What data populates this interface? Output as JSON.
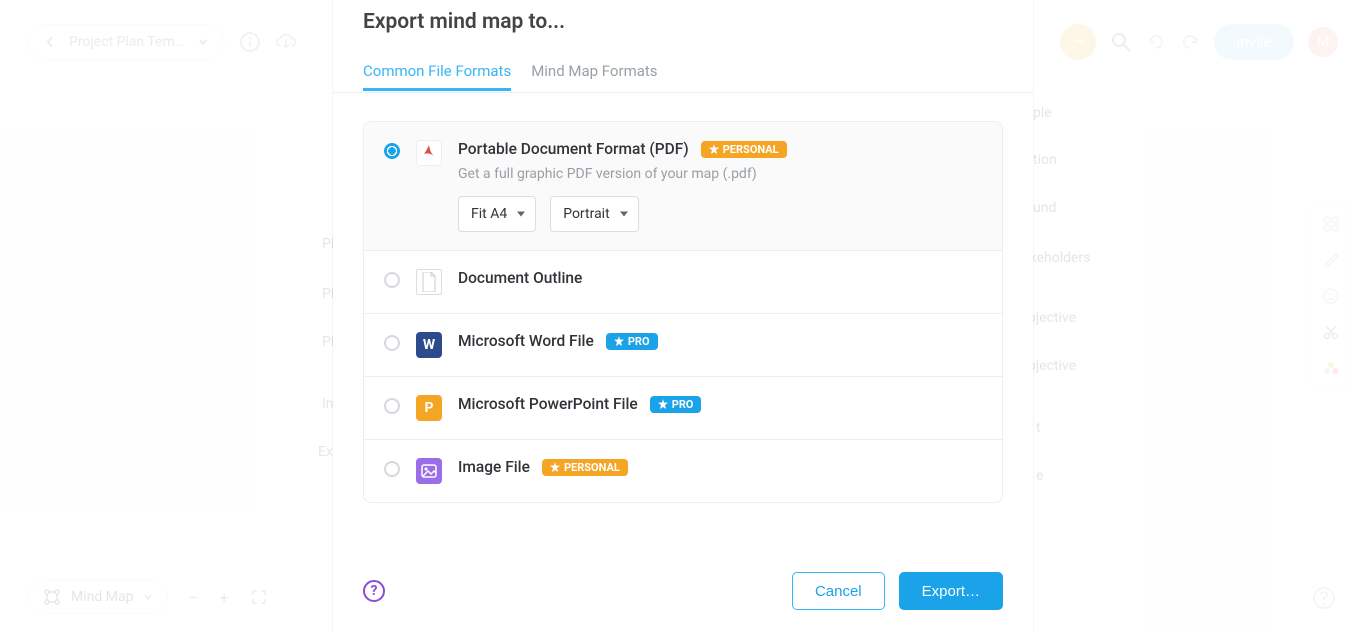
{
  "header": {
    "project_name": "Project Plan Tem…",
    "invite_label": "Invite",
    "avatar_initial": "M"
  },
  "canvas": {
    "left": {
      "ph1": "Ph",
      "ph2": "Ph",
      "ph3": "Ph",
      "in": "In",
      "ex": "Ex"
    },
    "right": {
      "ple": "ple",
      "tion": "tion",
      "und": "und",
      "akeholders": "akeholders",
      "objective1": "bjective",
      "objective2": "bjective",
      "t": "t",
      "e": "e"
    }
  },
  "bottom": {
    "mode_label": "Mind Map"
  },
  "modal": {
    "title": "Export mind map to...",
    "tabs": {
      "common": "Common File Formats",
      "mindmap": "Mind Map Formats"
    },
    "formats": {
      "pdf": {
        "title": "Portable Document Format (PDF)",
        "badge": "PERSONAL",
        "desc": "Get a full graphic PDF version of your map (.pdf)",
        "size_sel": "Fit A4",
        "orient_sel": "Portrait"
      },
      "outline": {
        "title": "Document Outline"
      },
      "word": {
        "title": "Microsoft Word File",
        "badge": "PRO"
      },
      "ppt": {
        "title": "Microsoft PowerPoint File",
        "badge": "PRO"
      },
      "image": {
        "title": "Image File",
        "badge": "PERSONAL"
      }
    },
    "footer": {
      "cancel": "Cancel",
      "export": "Export…"
    }
  }
}
